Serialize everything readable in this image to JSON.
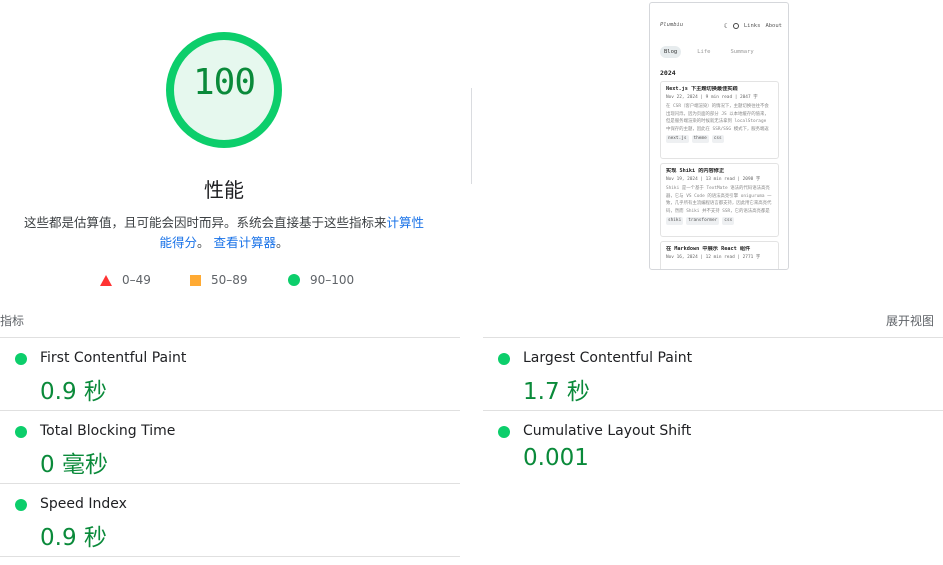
{
  "gauge": {
    "score": "100",
    "score_fraction": 1.0,
    "title": "性能",
    "description_prefix": "这些都是估算值，且可能会因时而异。系统会直接基于这些指标来",
    "link_calc": "计算性能得分",
    "description_mid": "。",
    "link_calculator": "查看计算器",
    "description_suffix": "。",
    "color_pass": "#0cce6b",
    "color_pass_bg": "#e6f8ee",
    "color_pass_text": "#0a8a3a"
  },
  "legend": [
    {
      "range": "0–49",
      "shape": "triangle",
      "color": "#ff3333"
    },
    {
      "range": "50–89",
      "shape": "square",
      "color": "#ffaa33"
    },
    {
      "range": "90–100",
      "shape": "circle",
      "color": "#0cce6b"
    }
  ],
  "thumbnail": {
    "brand": "Plumbiu",
    "nav": [
      "Links",
      "About"
    ],
    "tabs": [
      {
        "label": "Blog",
        "active": true
      },
      {
        "label": "Life",
        "active": false
      },
      {
        "label": "Summary",
        "active": false
      }
    ],
    "year": "2024",
    "cards": [
      {
        "title": "Next.js 下主题切换最佳实践",
        "meta": "Nov 22, 2024 | 9 min read | 2047 字",
        "body": "在 CSR（客户端渲染）的情况下，主题切换往往不会出现闪烁，因为页面的部分 JS 以本地缓存的值来，但是服务端渲染的时候就无法拿到 localStorage 中保存的主题，因此在 SSR/SSG 模式下，服务端返回的是一个页面的 HTML 文档，用 JS 执行后",
        "tags": [
          "next.js",
          "theme",
          "css"
        ]
      },
      {
        "title": "实现 Shiki 的内容修正",
        "meta": "Nov 19, 2024 | 13 min read | 2098 字",
        "body": "Shiki 是一个基于 TextMate 语法的代码语法高亮器，它与 VS Code 的语法高亮引擎 onigurumа 一致，几乎所有主流编程语言都支持，因此用它来高亮代码，然而 Shiki 并不支持 SSR，它的语法高亮都是通过 HTML 的 style",
        "tags": [
          "shiki",
          "transformer",
          "css"
        ]
      },
      {
        "title": "在 Markdown 中展示 React 组件",
        "meta": "Nov 16, 2024 | 12 min read | 2771 字",
        "body": "",
        "tags": []
      }
    ]
  },
  "metrics_header": {
    "label": "指标",
    "expand": "展开视图"
  },
  "metrics": [
    {
      "name": "First Contentful Paint",
      "value": "0.9 秒",
      "status": "pass"
    },
    {
      "name": "Largest Contentful Paint",
      "value": "1.7 秒",
      "status": "pass"
    },
    {
      "name": "Total Blocking Time",
      "value": "0 毫秒",
      "status": "pass"
    },
    {
      "name": "Cumulative Layout Shift",
      "value": "0.001",
      "status": "pass"
    },
    {
      "name": "Speed Index",
      "value": "0.9 秒",
      "status": "pass"
    }
  ]
}
